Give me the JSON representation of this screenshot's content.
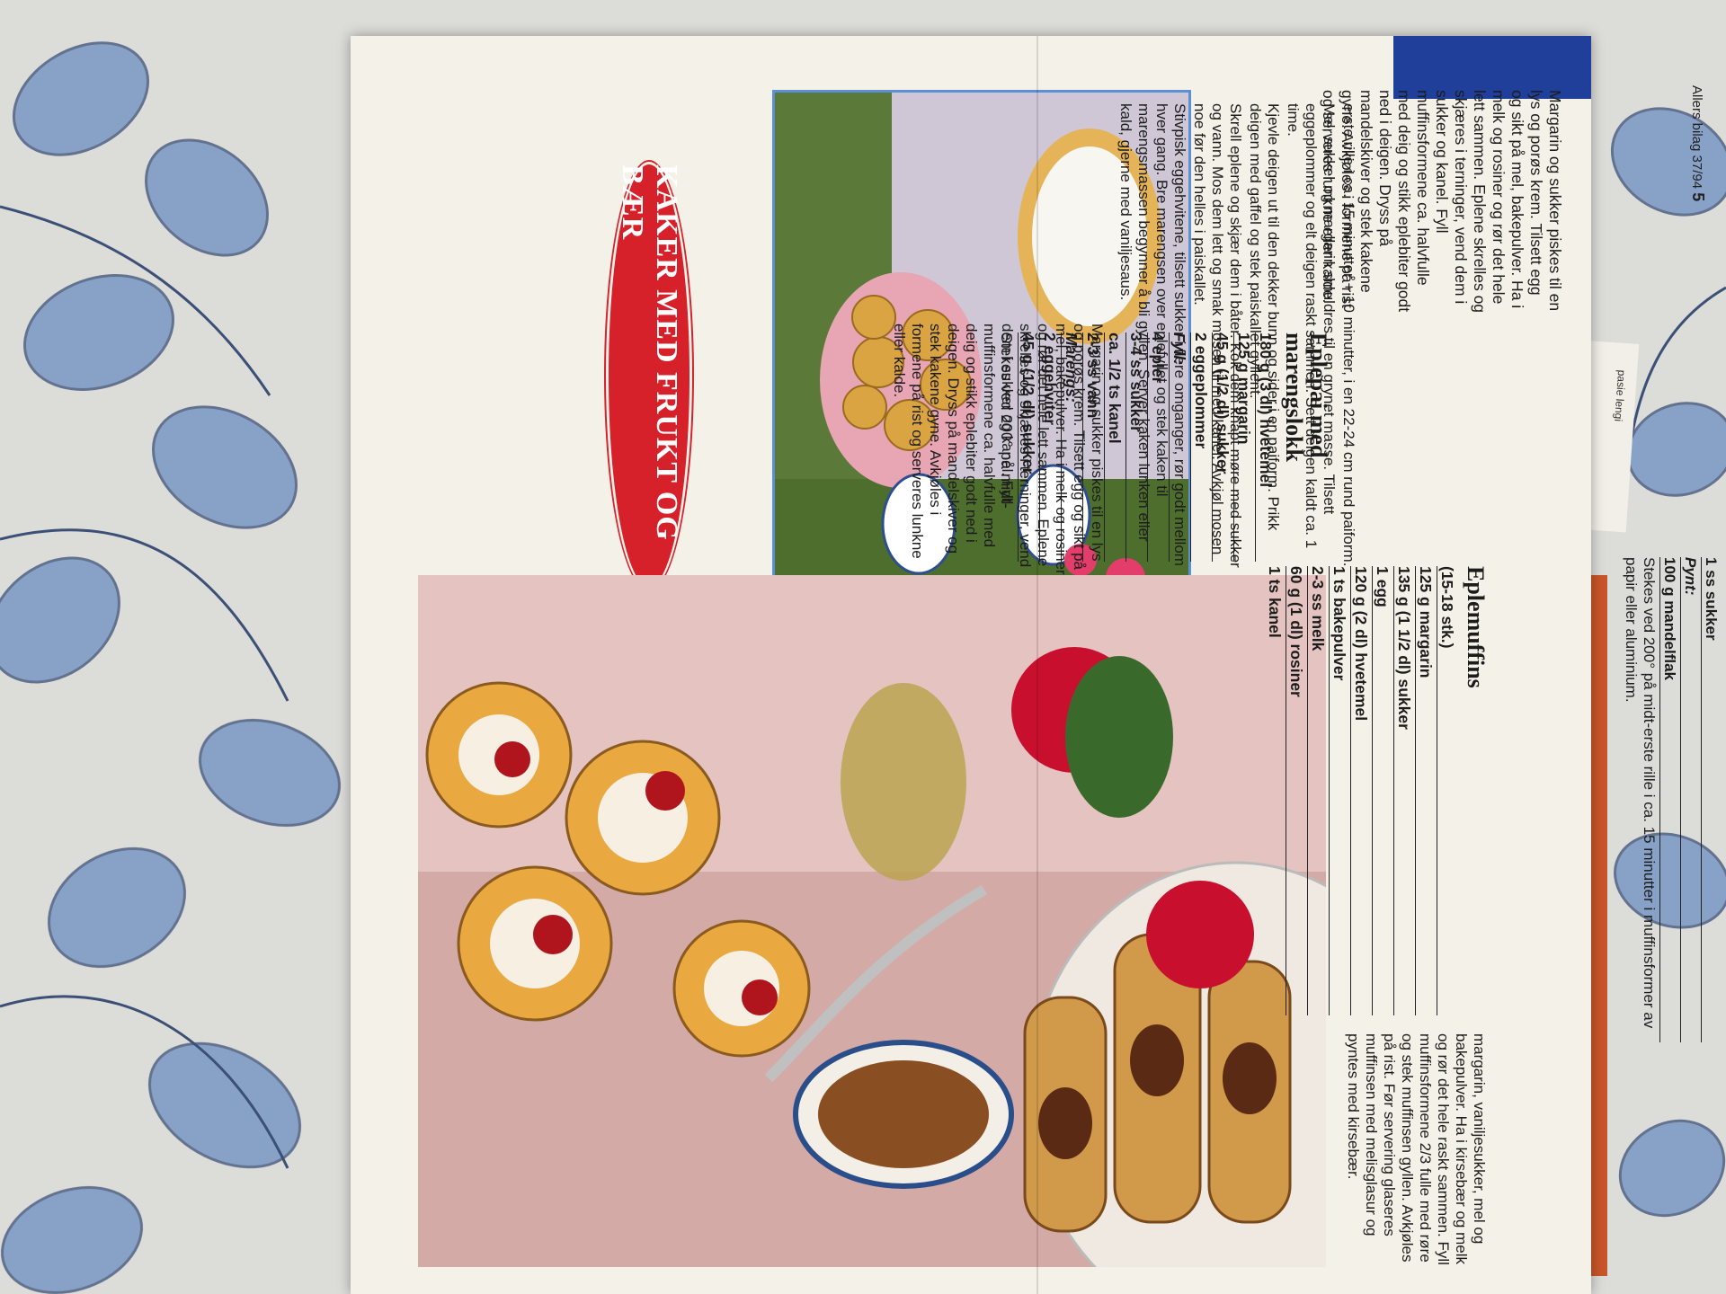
{
  "page": {
    "title": "KAKER MED FRUKT OG BÆR",
    "folio": "Allers bilag 37/94",
    "page_number": "5",
    "scrap_text": "pasie lengi"
  },
  "recipe1": {
    "title": "Eplemuffins",
    "ingredients": [
      "(15-18 stk.)",
      "125 g margarin",
      "135 g (1 1/2 dl) sukker",
      "1 egg",
      "120 g (2 dl) hvetemel",
      "1 ts bakepulver",
      "2-3 ss melk",
      "60 g (1 dl) rosiner",
      "1 ts kanel",
      "1 ss sukker"
    ],
    "pynt_label": "Pynt:",
    "pynt": [
      "100 g mandelflak"
    ],
    "method": [
      "Stekes ved 200° på midt-erste rille i ca. 15 minutter i muffinsformer av papir eller aluminium.",
      "Margarin og sukker piskes til en lys og porøs krem. Tilsett egg og sikt på mel, bakepulver. Ha i melk og rosiner og rør det hele lett sammen. Eplene skrelles og skjæres i terninger, vend dem i sukker og kanel. Fyll muffinsformene ca. halvfulle med deig og stikk eplebiter godt ned i deigen. Dryss på mandelskiver og stek kakene gyne. Avkjøles i formene på rist og serveres lunkne eller kalde."
    ]
  },
  "recipe_cont": {
    "method": "margarin, vaniljesukker, mel og bakepulver. Ha i kirsebær og melk og rør det hele raskt sammen. Fyll muffinsformene 2/3 fulle med røre og stek muffinsen gyllen. Avkjøles på rist. Før servering glaseres muffinsen med melisglasur og pyntes med kirsebær."
  },
  "recipe2": {
    "title": "Eplepai med marengslokk",
    "ingredients": [
      "180 g (3 dl) hvetemel",
      "125 g margarin",
      "45 g (1/2 dl) sukker",
      "2 eggeplommer"
    ],
    "fyll_label": "Fyll:",
    "fyll": [
      "4 epler",
      "3-4 ss sukker",
      "ca. 1/2 ts kanel",
      "2-3 ss vann"
    ],
    "marengs_label": "Marengs:",
    "marengs": [
      "2 eggehviter",
      "45 g (1/2 dl) sukker"
    ],
    "method_start": "Stekes ved 200° på midt-",
    "method": [
      "erste rille i ca. 15 minutter + 10 minutter, i en 22-24 cm rund paiform.",
      "Mel, sukker og margarin smuldres til en grynet masse. Tilsett eggeplommer og elt deigen raskt sammen. Sett deigen kaldt ca. 1 time.",
      "Kjevle deigen ut til den dekker bunn og sider i en paiform. Prikk deigen med gaffel og stek paiskallet gyllent.",
      "Skrell eplene og skjær dem i båter. Kok dem knapt møre med sukker og vann. Mos dem lett og smak mosen til med kanel. Avkjøl mosen noe før den helles i paiskallet.",
      "Stivpisk eggehvitene, tilsett sukker i flere omganger, rør godt mellom hver gang. Bre marengsen over eplefyllet og stek kaken til marengsmassen begynner å bli gyllen. Server kaken lunken eller kald, gjerne med vaniljesaus."
    ]
  },
  "colors": {
    "cloth": "#dcdcd8",
    "leaf_blue": "#5d7fb3",
    "title_red": "#d6202a",
    "paper": "#f4f1e8",
    "photo_frame": "#5b8fd6"
  }
}
